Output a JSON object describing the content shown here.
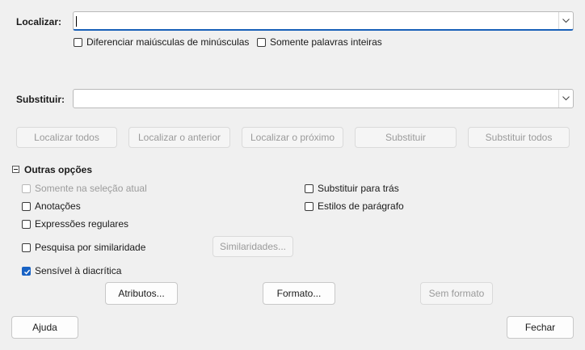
{
  "find": {
    "label": "Localizar:",
    "value": ""
  },
  "options": {
    "match_case": {
      "label": "Diferenciar maiúsculas de minúsculas",
      "checked": false
    },
    "whole_words": {
      "label": "Somente palavras inteiras",
      "checked": false
    }
  },
  "replace": {
    "label": "Substituir:",
    "value": ""
  },
  "buttons": {
    "find_all": "Localizar todos",
    "find_previous": "Localizar o anterior",
    "find_next": "Localizar o próximo",
    "replace": "Substituir",
    "replace_all": "Substituir todos"
  },
  "more_options": {
    "label": "Outras opções",
    "current_selection_only": {
      "label": "Somente na seleção atual",
      "checked": false,
      "enabled": false
    },
    "replace_backwards": {
      "label": "Substituir para trás",
      "checked": false
    },
    "comments": {
      "label": "Anotações",
      "checked": false
    },
    "paragraph_styles": {
      "label": "Estilos de parágrafo",
      "checked": false
    },
    "regular_expressions": {
      "label": "Expressões regulares",
      "checked": false
    },
    "similarity_search": {
      "label": "Pesquisa por similaridade",
      "checked": false
    },
    "similarities_button": "Similaridades...",
    "diacritic_sensitive": {
      "label": "Sensível à diacrítica",
      "checked": true
    },
    "attributes_button": "Atributos...",
    "format_button": "Formato...",
    "no_format_button": "Sem formato"
  },
  "footer": {
    "help": "Ajuda",
    "close": "Fechar"
  },
  "colors": {
    "accent": "#1862c4",
    "background": "#f0f0f0"
  }
}
